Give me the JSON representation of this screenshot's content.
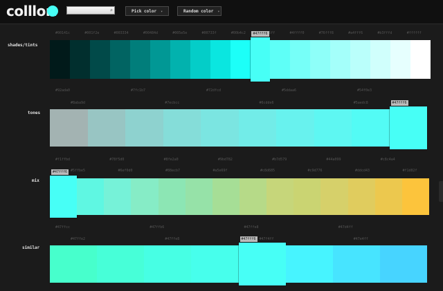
{
  "header": {
    "logo": "colllor",
    "logo_colon": ":",
    "current_color": "#47fff6",
    "search_value": "",
    "search_icon": "search-icon",
    "pick_label": "Pick color",
    "random_label": "Random color",
    "caret": "▾"
  },
  "sections": [
    {
      "label": "shades/tints",
      "selected": "#47fff6",
      "colors": [
        "#011a1a",
        "#012f2e",
        "#014a49",
        "#016462",
        "#017e7b",
        "#019895",
        "#02b2ae",
        "#04cdc8",
        "#0ae6e0",
        "#1cfff8",
        "#47fff6",
        "#5efff7",
        "#76fff8",
        "#8efff9",
        "#a4fffa",
        "#bafffb",
        "#d0fffc",
        "#e6fffe",
        "#ffffff"
      ],
      "hexes_top": [
        "#00141c",
        "#001f2e",
        "#003334",
        "#00484d",
        "#005e5e",
        "#00733f",
        "#00b4c2",
        "#2ff5ff",
        "#4ffff0",
        "#76fff8",
        "#a4fff6",
        "#b3fffd",
        "#ffffff"
      ]
    },
    {
      "label": "tones",
      "selected": "#47fff6",
      "colors": [
        "#a3b3b2",
        "#98c5c3",
        "#8ed2cf",
        "#85ddd9",
        "#7be5e1",
        "#72ece8",
        "#68f2ee",
        "#5ef7f2",
        "#53fbf5",
        "#47fff6"
      ],
      "hexes_top": [
        "#92ada0",
        "#7fc1b7",
        "#72dfcd",
        "#5ddaa6",
        "#54f0e3"
      ],
      "hexes_bot": [
        "#8aba9d",
        "#7ecbcc",
        "#6cdde6",
        "#5aedc8"
      ]
    },
    {
      "label": "mix",
      "selected": "#47fff6",
      "colors": [
        "#47fff6",
        "#5ff7e2",
        "#76f2d8",
        "#86ecc6",
        "#8ce6b4",
        "#96e2a8",
        "#a6de96",
        "#b6da88",
        "#c6d67a",
        "#cad472",
        "#d6d06a",
        "#e0cc5e",
        "#ecc84e",
        "#fcc43c"
      ],
      "hexes_top": [
        "#f1ffbd",
        "#78f5d0",
        "#8fe2a0",
        "#9bd782",
        "#b7d579",
        "#44a099",
        "#c8c4a4"
      ],
      "hexes_bot": [
        "#5ffbe5",
        "#6ef0d0",
        "#88ecb7",
        "#a5e69f",
        "#c8d685",
        "#c9d776",
        "#ddcd43",
        "#f1d82f"
      ]
    },
    {
      "label": "similar",
      "selected": "#47fff6",
      "colors": [
        "#47ffcc",
        "#47ffd8",
        "#47ffe4",
        "#47ffec",
        "#47fff6",
        "#47f4ff",
        "#47e4ff",
        "#47d4ff"
      ],
      "hexes_top": [
        "#47ffcc",
        "#47ffb6",
        "#47ffe8",
        "#47d4ff"
      ],
      "hexes_bot": [
        "#47ffe2",
        "#47ffe8",
        "#47f4ff",
        "#47e4ff"
      ]
    }
  ]
}
